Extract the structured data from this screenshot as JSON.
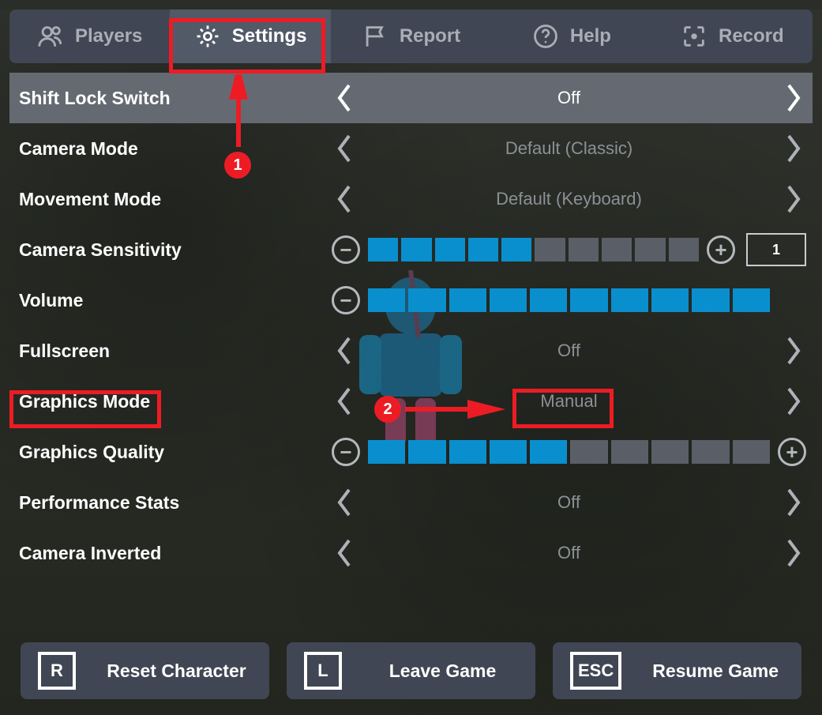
{
  "tabs": {
    "players": "Players",
    "settings": "Settings",
    "report": "Report",
    "help": "Help",
    "record": "Record"
  },
  "settings": {
    "shift_lock": {
      "label": "Shift Lock Switch",
      "value": "Off"
    },
    "camera_mode": {
      "label": "Camera Mode",
      "value": "Default (Classic)"
    },
    "movement_mode": {
      "label": "Movement Mode",
      "value": "Default (Keyboard)"
    },
    "camera_sensitivity": {
      "label": "Camera Sensitivity",
      "value": "1",
      "filled": 5,
      "total": 10
    },
    "volume": {
      "label": "Volume",
      "filled": 10,
      "total": 10
    },
    "fullscreen": {
      "label": "Fullscreen",
      "value": "Off"
    },
    "graphics_mode": {
      "label": "Graphics Mode",
      "value": "Manual"
    },
    "graphics_quality": {
      "label": "Graphics Quality",
      "filled": 5,
      "total": 10
    },
    "performance_stats": {
      "label": "Performance Stats",
      "value": "Off"
    },
    "camera_inverted": {
      "label": "Camera Inverted",
      "value": "Off"
    }
  },
  "buttons": {
    "reset": {
      "key": "R",
      "label": "Reset Character"
    },
    "leave": {
      "key": "L",
      "label": "Leave Game"
    },
    "resume": {
      "key": "ESC",
      "label": "Resume Game"
    }
  },
  "annotations": {
    "badge1": "1",
    "badge2": "2"
  }
}
